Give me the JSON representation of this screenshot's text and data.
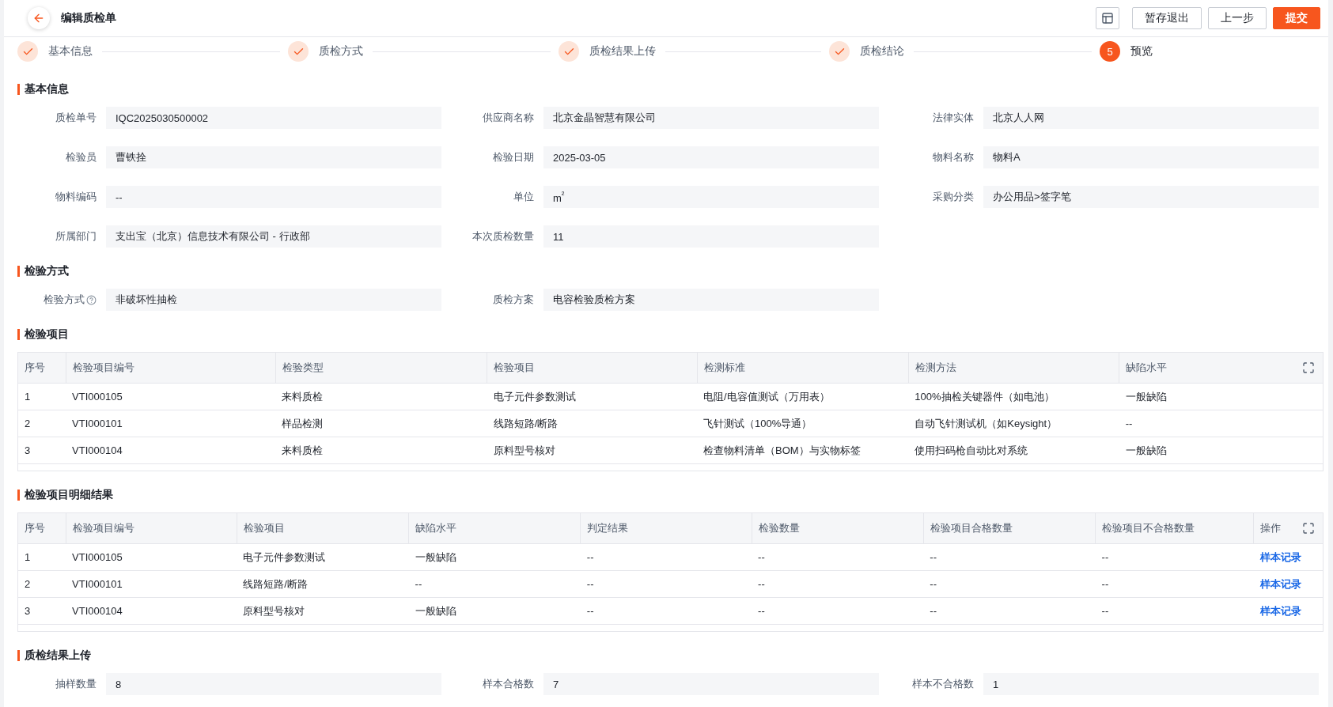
{
  "header": {
    "title": "编辑质检单",
    "buttons": [
      {
        "label": "暂存退出",
        "kind": "default"
      },
      {
        "label": "上一步",
        "kind": "default"
      },
      {
        "label": "提交",
        "kind": "primary"
      }
    ]
  },
  "steps": [
    {
      "label": "基本信息",
      "completed": true
    },
    {
      "label": "质检方式",
      "completed": true
    },
    {
      "label": "质检结果上传",
      "completed": true
    },
    {
      "label": "质检结论",
      "completed": true
    },
    {
      "label": "预览",
      "completed": false,
      "number": "5"
    }
  ],
  "sections": [
    {
      "title": "基本信息",
      "kind": "form",
      "fields": [
        {
          "label": "质检单号",
          "value": "IQC2025030500002"
        },
        {
          "label": "供应商名称",
          "value": "北京金晶智慧有限公司"
        },
        {
          "label": "法律实体",
          "value": "北京人人网"
        },
        {
          "label": "检验员",
          "value": "曹铁拴"
        },
        {
          "label": "检验日期",
          "value": "2025-03-05"
        },
        {
          "label": "物料名称",
          "value": "物料A"
        },
        {
          "label": "物料编码",
          "value": "--"
        },
        {
          "label": "单位",
          "value": "m$^{²}$"
        },
        {
          "label": "采购分类",
          "value": "办公用品>签字笔"
        },
        {
          "label": "所属部门",
          "value": "支出宝（北京）信息技术有限公司 - 行政部"
        },
        {
          "label": "本次质检数量",
          "value": "11"
        }
      ]
    },
    {
      "title": "检验方式",
      "kind": "form",
      "fields": [
        {
          "label": "检验方式",
          "value": "非破坏性抽检",
          "help": true
        },
        {
          "label": "质检方案",
          "value": "电容检验质检方案"
        }
      ]
    },
    {
      "title": "检验项目",
      "kind": "table",
      "columns": [
        {
          "label": "序号",
          "kind": "text"
        },
        {
          "label": "检验项目编号",
          "kind": "text"
        },
        {
          "label": "检验类型",
          "kind": "text"
        },
        {
          "label": "检验项目",
          "kind": "text"
        },
        {
          "label": "检测标准",
          "kind": "text"
        },
        {
          "label": "检测方法",
          "kind": "text"
        },
        {
          "label": "缺陷水平",
          "kind": "text"
        }
      ],
      "rows": [
        [
          "1",
          "VTI000105",
          "来料质检",
          "电子元件参数测试",
          "电阻/电容值测试（万用表）",
          "100%抽检关键器件（如电池）",
          "一般缺陷"
        ],
        [
          "2",
          "VTI000101",
          "样品检测",
          "线路短路/断路",
          "飞针测试（100%导通）",
          "自动飞针测试机（如Keysight）",
          "--"
        ],
        [
          "3",
          "VTI000104",
          "来料质检",
          "原料型号核对",
          "检查物料清单（BOM）与实物标签",
          "使用扫码枪自动比对系统",
          "一般缺陷"
        ]
      ]
    },
    {
      "title": "检验项目明细结果",
      "kind": "table",
      "columns": [
        {
          "label": "序号",
          "kind": "text"
        },
        {
          "label": "检验项目编号",
          "kind": "text"
        },
        {
          "label": "检验项目",
          "kind": "text"
        },
        {
          "label": "缺陷水平",
          "kind": "text"
        },
        {
          "label": "判定结果",
          "kind": "text"
        },
        {
          "label": "检验数量",
          "kind": "text"
        },
        {
          "label": "检验项目合格数量",
          "kind": "text"
        },
        {
          "label": "检验项目不合格数量",
          "kind": "text"
        },
        {
          "label": "操作",
          "kind": "link"
        }
      ],
      "rows": [
        [
          "1",
          "VTI000105",
          "电子元件参数测试",
          "一般缺陷",
          "--",
          "--",
          "--",
          "--",
          "样本记录"
        ],
        [
          "2",
          "VTI000101",
          "线路短路/断路",
          "--",
          "--",
          "--",
          "--",
          "--",
          "样本记录"
        ],
        [
          "3",
          "VTI000104",
          "原料型号核对",
          "一般缺陷",
          "--",
          "--",
          "--",
          "--",
          "样本记录"
        ]
      ]
    },
    {
      "title": "质检结果上传",
      "kind": "form",
      "fields": [
        {
          "label": "抽样数量",
          "value": "8"
        },
        {
          "label": "样本合格数",
          "value": "7"
        },
        {
          "label": "样本不合格数",
          "value": "1"
        }
      ]
    }
  ]
}
